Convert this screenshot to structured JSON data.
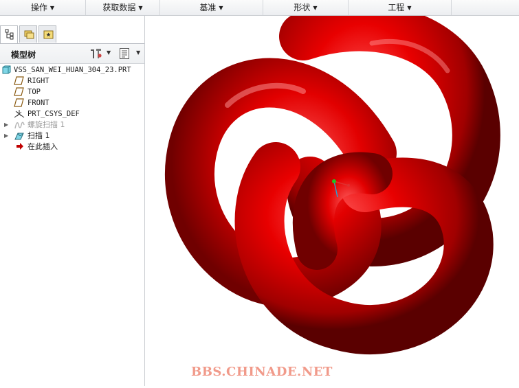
{
  "ribbon": {
    "groups": [
      {
        "label": "操作"
      },
      {
        "label": "获取数据"
      },
      {
        "label": "基准"
      },
      {
        "label": "形状"
      },
      {
        "label": "工程"
      }
    ]
  },
  "left_panel": {
    "title": "模型树",
    "tabs": [
      "model-tree-tab",
      "layers-tab",
      "favorites-tab"
    ],
    "tree": {
      "root": "VSS_SAN_WEI_HUAN_304_23.PRT",
      "items": [
        {
          "label": "RIGHT",
          "icon": "datum-plane-icon"
        },
        {
          "label": "TOP",
          "icon": "datum-plane-icon"
        },
        {
          "label": "FRONT",
          "icon": "datum-plane-icon"
        },
        {
          "label": "PRT_CSYS_DEF",
          "icon": "csys-icon"
        },
        {
          "label": "螺旋扫描 1",
          "icon": "helical-sweep-icon",
          "suppressed": true
        },
        {
          "label": "扫描 1",
          "icon": "sweep-icon"
        },
        {
          "label": "在此插入",
          "icon": "insert-here-arrow-icon"
        }
      ]
    }
  },
  "viewport": {
    "model": "trefoil-knot",
    "color": "#e00000",
    "watermark": "BBS.CHINADE.NET"
  },
  "colors": {
    "ribbon_bg": "#eceef1",
    "model_red": "#e00000",
    "watermark": "#f19a8a",
    "insert_arrow": "#c00000"
  }
}
